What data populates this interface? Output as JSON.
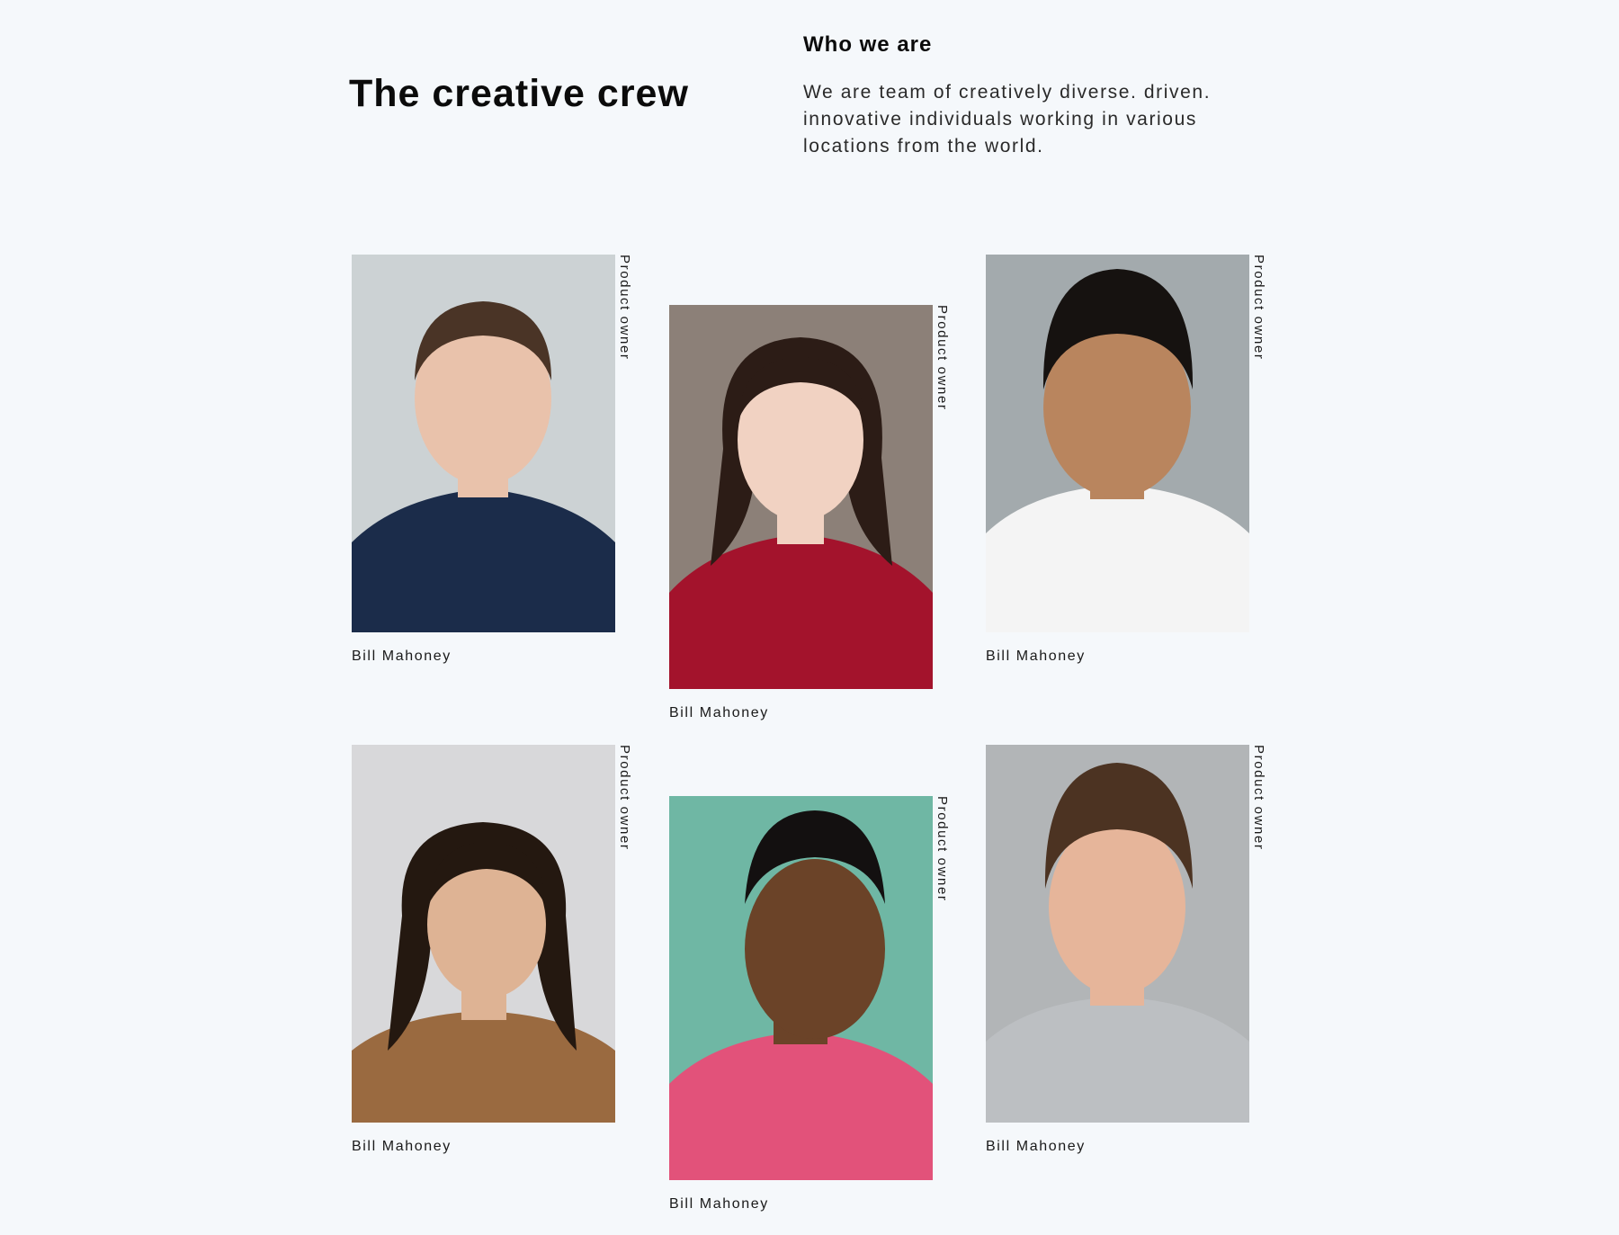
{
  "header": {
    "title": "The creative crew",
    "who_heading": "Who we are",
    "who_text": "We are team of creatively diverse. driven. innovative individuals working in various locations from the world."
  },
  "team": [
    {
      "name": "Bill Mahoney",
      "role": "Product owner",
      "photo_bg": "#ccd2d4",
      "skin": "#e9c2ab",
      "hair": "#4a3426",
      "shirt": "#1b2c4a"
    },
    {
      "name": "Bill Mahoney",
      "role": "Product owner",
      "photo_bg": "#8c8078",
      "skin": "#f1d2c2",
      "hair": "#2c1c16",
      "shirt": "#a3132c"
    },
    {
      "name": "Bill Mahoney",
      "role": "Product owner",
      "photo_bg": "#a3aaad",
      "skin": "#b9855e",
      "hair": "#161210",
      "shirt": "#f4f4f4"
    },
    {
      "name": "Bill Mahoney",
      "role": "Product owner",
      "photo_bg": "#d8d8da",
      "skin": "#deb394",
      "hair": "#241810",
      "shirt": "#9a6a40"
    },
    {
      "name": "Bill Mahoney",
      "role": "Product owner",
      "photo_bg": "#6fb7a4",
      "skin": "#6b4328",
      "hair": "#131010",
      "shirt": "#e2527a"
    },
    {
      "name": "Bill Mahoney",
      "role": "Product owner",
      "photo_bg": "#b2b5b7",
      "skin": "#e6b59a",
      "hair": "#4c3322",
      "shirt": "#bcbfc2"
    }
  ]
}
